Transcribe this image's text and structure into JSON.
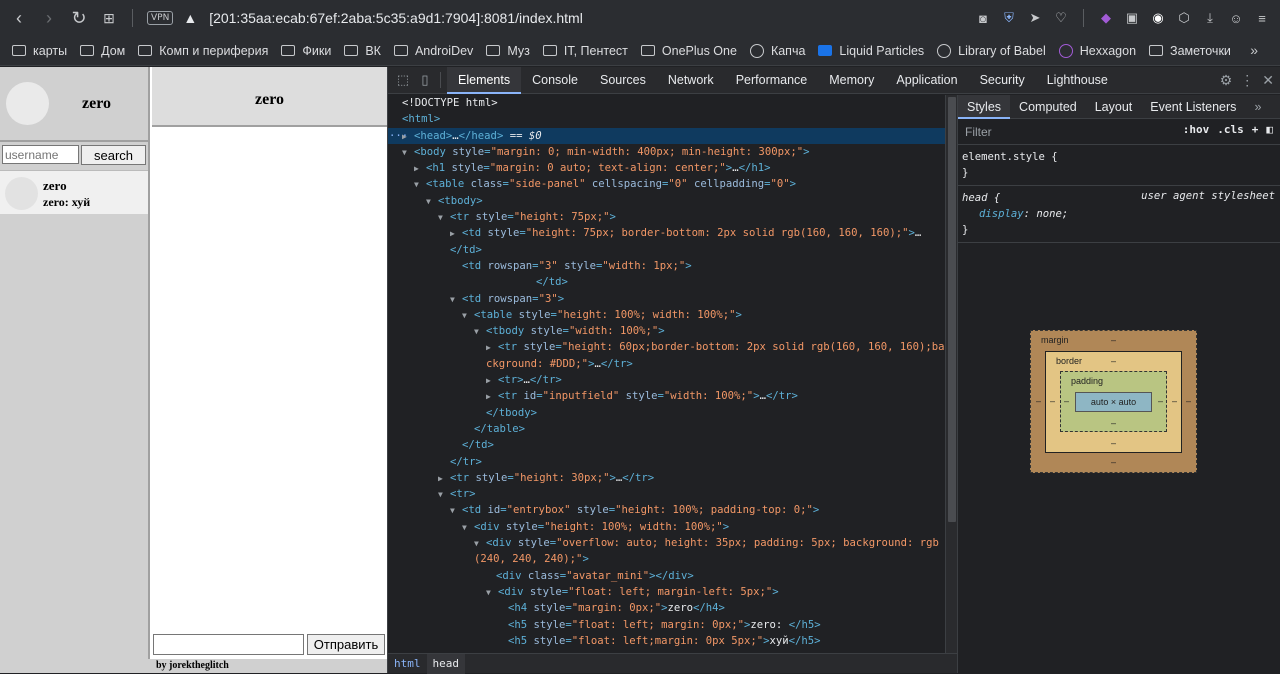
{
  "browser": {
    "vpn_label": "VPN",
    "url": "[201:35aa:ecab:67ef:2aba:5c35:a9d1:7904]:8081/index.html",
    "bookmarks": [
      "карты",
      "Дом",
      "Комп и периферия",
      "Фики",
      "ВК",
      "AndroiDev",
      "Муз",
      "IT, Пентест",
      "OnePlus One",
      "Капча",
      "Liquid Particles",
      "Library of Babel",
      "Hexxagon",
      "Заметочки"
    ]
  },
  "page": {
    "side_name": "zero",
    "search_placeholder": "username",
    "search_button": "search",
    "entry_name": "zero",
    "entry_message": "zero:  хуй",
    "main_title": "zero",
    "send_button": "Отправить",
    "footer": "by jorektheglitch"
  },
  "devtools": {
    "tabs": [
      "Elements",
      "Console",
      "Sources",
      "Network",
      "Performance",
      "Memory",
      "Application",
      "Security",
      "Lighthouse"
    ],
    "active_tab": "Elements",
    "breadcrumbs": [
      "html",
      "head"
    ],
    "styles_tabs": [
      "Styles",
      "Computed",
      "Layout",
      "Event Listeners"
    ],
    "filter_placeholder": "Filter",
    "hov": ":hov",
    "cls": ".cls",
    "element_style": "element.style {",
    "close_brace": "}",
    "head_rule": "head {",
    "head_source": "user agent stylesheet",
    "head_prop": "display",
    "head_val": "none;",
    "box": {
      "margin": "margin",
      "border": "border",
      "padding": "padding",
      "dash": "–",
      "content": "auto × auto"
    }
  }
}
